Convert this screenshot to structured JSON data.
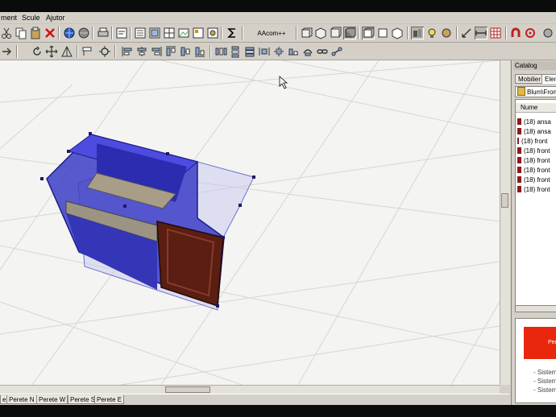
{
  "menu": {
    "items": [
      "ment",
      "Scule",
      "Ajutor"
    ]
  },
  "toolbar": {
    "aacom_label": "AAcom++"
  },
  "view_tabs": [
    "en",
    "Perete N",
    "Perete W",
    "Perete S",
    "Perete E"
  ],
  "catalog": {
    "title": "Catalog",
    "tabs": [
      "Mobilier",
      "Elem"
    ],
    "path": "Blum\\Fron",
    "column_header": "Nume",
    "items": [
      "(18) ansa",
      "(18) ansa",
      "(18) front",
      "(18) front",
      "(18) front",
      "(18) front",
      "(18) front",
      "(18) front"
    ],
    "ad_text": "Perfectio",
    "preview_lines": [
      "- Sistem",
      "- Sistem",
      "- Sistem"
    ]
  },
  "colors": {
    "selection": "#3c3cc8",
    "door": "#5a1e12",
    "ad_red": "#e8270c"
  }
}
